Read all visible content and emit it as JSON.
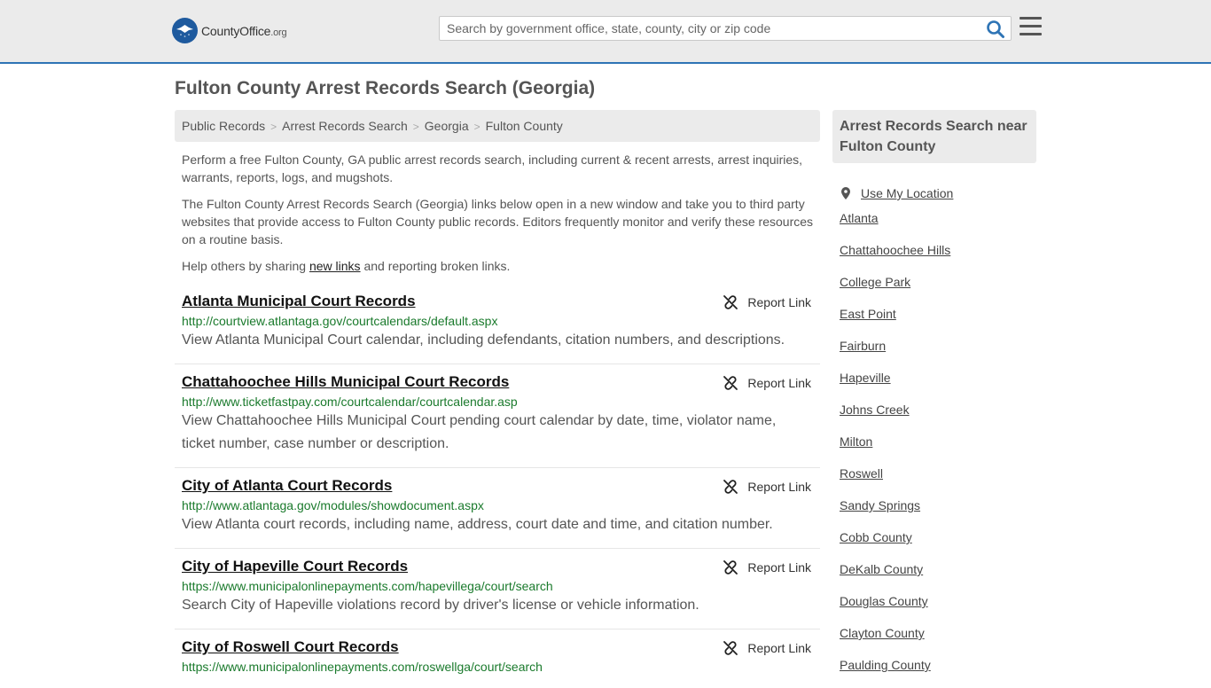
{
  "header": {
    "logo_name": "CountyOffice",
    "logo_tld": ".org",
    "search_placeholder": "Search by government office, state, county, city or zip code"
  },
  "page": {
    "title": "Fulton County Arrest Records Search (Georgia)",
    "breadcrumb": [
      "Public Records",
      "Arrest Records Search",
      "Georgia",
      "Fulton County"
    ],
    "intro1": "Perform a free Fulton County, GA public arrest records search, including current & recent arrests, arrest inquiries, warrants, reports, logs, and mugshots.",
    "intro2": "The Fulton County Arrest Records Search (Georgia) links below open in a new window and take you to third party websites that provide access to Fulton County public records. Editors frequently monitor and verify these resources on a routine basis.",
    "help_prefix": "Help others by sharing ",
    "help_link": "new links",
    "help_suffix": " and reporting broken links."
  },
  "results": [
    {
      "title": "Atlanta Municipal Court Records",
      "url": "http://courtview.atlantaga.gov/courtcalendars/default.aspx",
      "desc": "View Atlanta Municipal Court calendar, including defendants, citation numbers, and descriptions.",
      "report": "Report Link"
    },
    {
      "title": "Chattahoochee Hills Municipal Court Records",
      "url": "http://www.ticketfastpay.com/courtcalendar/courtcalendar.asp",
      "desc": "View Chattahoochee Hills Municipal Court pending court calendar by date, time, violator name, ticket number, case number or description.",
      "report": "Report Link"
    },
    {
      "title": "City of Atlanta Court Records",
      "url": "http://www.atlantaga.gov/modules/showdocument.aspx",
      "desc": "View Atlanta court records, including name, address, court date and time, and citation number.",
      "report": "Report Link"
    },
    {
      "title": "City of Hapeville Court Records",
      "url": "https://www.municipalonlinepayments.com/hapevillega/court/search",
      "desc": "Search City of Hapeville violations record by driver's license or vehicle information.",
      "report": "Report Link"
    },
    {
      "title": "City of Roswell Court Records",
      "url": "https://www.municipalonlinepayments.com/roswellga/court/search",
      "desc": "",
      "report": "Report Link"
    }
  ],
  "sidebar": {
    "heading": "Arrest Records Search near Fulton County",
    "use_location": "Use My Location",
    "items": [
      "Atlanta",
      "Chattahoochee Hills",
      "College Park",
      "East Point",
      "Fairburn",
      "Hapeville",
      "Johns Creek",
      "Milton",
      "Roswell",
      "Sandy Springs",
      "Cobb County",
      "DeKalb County",
      "Douglas County",
      "Clayton County",
      "Paulding County"
    ]
  }
}
